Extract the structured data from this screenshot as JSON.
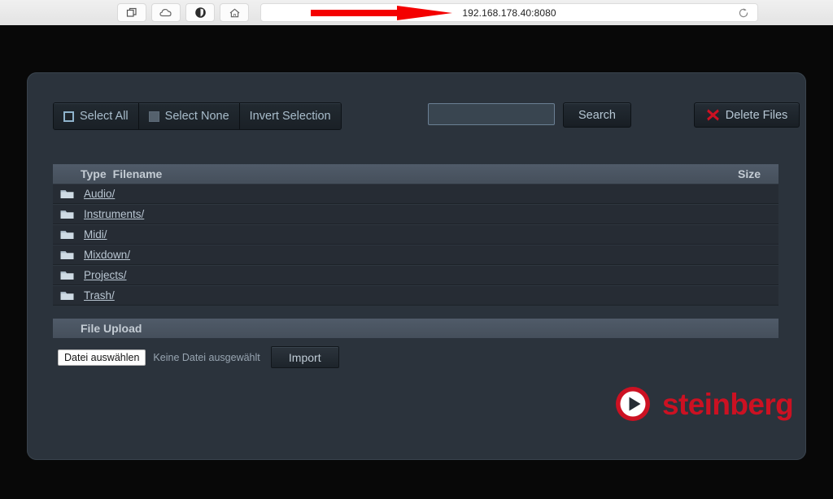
{
  "browser": {
    "url": "192.168.178.40:8080",
    "toolbar_icons": [
      {
        "name": "tabs-icon",
        "label": "Tabs"
      },
      {
        "name": "cloud-icon",
        "label": "Cloud"
      },
      {
        "name": "shield-icon",
        "label": "Privacy"
      },
      {
        "name": "home-icon",
        "label": "Home"
      }
    ],
    "reload_icon": "reload-icon",
    "annotation": "red-arrow-pointing-to-url"
  },
  "toolbar": {
    "select_all": "Select All",
    "select_none": "Select None",
    "invert_selection": "Invert Selection",
    "search_value": "",
    "search_placeholder": "",
    "search_button": "Search",
    "delete_files": "Delete Files",
    "delete_icon": "red-x-icon"
  },
  "table": {
    "columns": {
      "type": "Type",
      "filename": "Filename",
      "size": "Size"
    },
    "rows": [
      {
        "icon": "folder-icon",
        "name": "Audio/",
        "size": ""
      },
      {
        "icon": "folder-icon",
        "name": "Instruments/",
        "size": ""
      },
      {
        "icon": "folder-icon",
        "name": "Midi/",
        "size": ""
      },
      {
        "icon": "folder-icon",
        "name": "Mixdown/",
        "size": ""
      },
      {
        "icon": "folder-icon",
        "name": "Projects/",
        "size": ""
      },
      {
        "icon": "folder-icon",
        "name": "Trash/",
        "size": ""
      }
    ]
  },
  "upload": {
    "section_title": "File Upload",
    "choose_button": "Datei auswählen",
    "status_text": "Keine Datei ausgewählt",
    "import_button": "Import"
  },
  "branding": {
    "wordmark": "steinberg",
    "logo_icon": "steinberg-play-logo"
  },
  "colors": {
    "panel_bg": "#2b333c",
    "section_bar": "#4a5562",
    "row_bg": "#262c34",
    "accent_red": "#cc1122",
    "link_text": "#b9c6d2",
    "button_text": "#b6c7d4"
  }
}
